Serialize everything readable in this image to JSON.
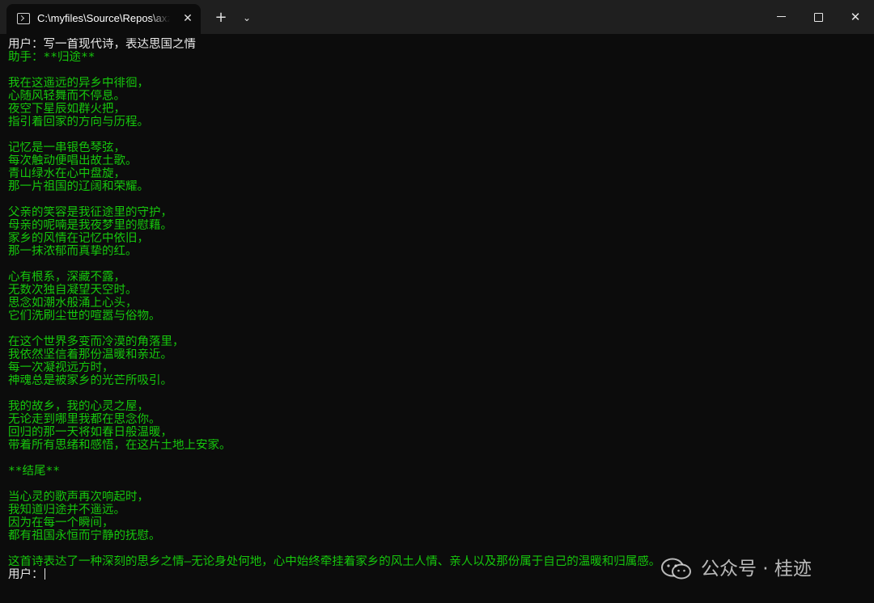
{
  "window": {
    "tab_title": "C:\\myfiles\\Source\\Repos\\axzxs",
    "tab_close": "✕",
    "new_tab": "+",
    "dropdown": "⌄",
    "close_glyph": "✕"
  },
  "terminal": {
    "lines": [
      {
        "text": "用户：写一首现代诗，表达思国之情",
        "role": "user"
      },
      {
        "text": "助手：**归途**",
        "role": "assistant"
      },
      {
        "text": "",
        "role": "assistant"
      },
      {
        "text": "我在这遥远的异乡中徘徊，",
        "role": "assistant"
      },
      {
        "text": "心随风轻舞而不停息。",
        "role": "assistant"
      },
      {
        "text": "夜空下星辰如群火把，",
        "role": "assistant"
      },
      {
        "text": "指引着回家的方向与历程。",
        "role": "assistant"
      },
      {
        "text": "",
        "role": "assistant"
      },
      {
        "text": "记忆是一串银色琴弦，",
        "role": "assistant"
      },
      {
        "text": "每次触动便唱出故土歌。",
        "role": "assistant"
      },
      {
        "text": "青山绿水在心中盘旋，",
        "role": "assistant"
      },
      {
        "text": "那一片祖国的辽阔和荣耀。",
        "role": "assistant"
      },
      {
        "text": "",
        "role": "assistant"
      },
      {
        "text": "父亲的笑容是我征途里的守护，",
        "role": "assistant"
      },
      {
        "text": "母亲的呢喃是我夜梦里的慰藉。",
        "role": "assistant"
      },
      {
        "text": "家乡的风情在记忆中依旧，",
        "role": "assistant"
      },
      {
        "text": "那一抹浓郁而真挚的红。",
        "role": "assistant"
      },
      {
        "text": "",
        "role": "assistant"
      },
      {
        "text": "心有根系，深藏不露，",
        "role": "assistant"
      },
      {
        "text": "无数次独自凝望天空时。",
        "role": "assistant"
      },
      {
        "text": "思念如潮水般涌上心头，",
        "role": "assistant"
      },
      {
        "text": "它们洗刷尘世的喧嚣与俗物。",
        "role": "assistant"
      },
      {
        "text": "",
        "role": "assistant"
      },
      {
        "text": "在这个世界多变而冷漠的角落里，",
        "role": "assistant"
      },
      {
        "text": "我依然坚信着那份温暖和亲近。",
        "role": "assistant"
      },
      {
        "text": "每一次凝视远方时，",
        "role": "assistant"
      },
      {
        "text": "神魂总是被家乡的光芒所吸引。",
        "role": "assistant"
      },
      {
        "text": "",
        "role": "assistant"
      },
      {
        "text": "我的故乡，我的心灵之屋，",
        "role": "assistant"
      },
      {
        "text": "无论走到哪里我都在思念你。",
        "role": "assistant"
      },
      {
        "text": "回归的那一天将如春日般温暖，",
        "role": "assistant"
      },
      {
        "text": "带着所有思绪和感悟，在这片土地上安家。",
        "role": "assistant"
      },
      {
        "text": "",
        "role": "assistant"
      },
      {
        "text": "**结尾**",
        "role": "assistant"
      },
      {
        "text": "",
        "role": "assistant"
      },
      {
        "text": "当心灵的歌声再次响起时，",
        "role": "assistant"
      },
      {
        "text": "我知道归途并不遥远。",
        "role": "assistant"
      },
      {
        "text": "因为在每一个瞬间，",
        "role": "assistant"
      },
      {
        "text": "都有祖国永恒而宁静的抚慰。",
        "role": "assistant"
      },
      {
        "text": "",
        "role": "assistant"
      },
      {
        "text": "这首诗表达了一种深刻的思乡之情—无论身处何地，心中始终牵挂着家乡的风土人情、亲人以及那份属于自己的温暖和归属感。",
        "role": "assistant"
      }
    ],
    "prompt": "用户："
  },
  "watermark": {
    "text": "公众号 · 桂迹",
    "logo_icon": "wechat-icon"
  }
}
